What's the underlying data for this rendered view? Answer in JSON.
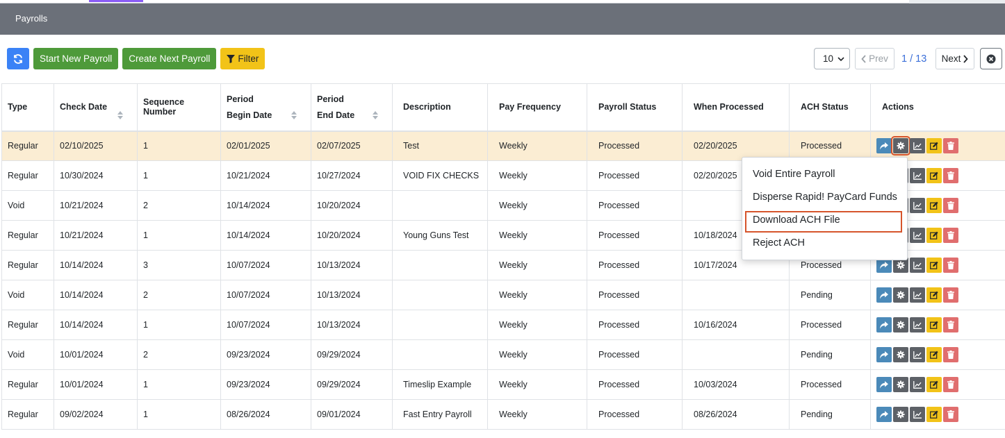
{
  "header": {
    "title": "Payrolls"
  },
  "toolbar": {
    "start_new": "Start New Payroll",
    "create_next": "Create Next Payroll",
    "filter": "Filter"
  },
  "pagination": {
    "per_page": "10",
    "prev": "Prev",
    "page": "1 / 13",
    "next": "Next"
  },
  "table": {
    "headers": {
      "type": "Type",
      "check_date": "Check Date",
      "sequence": "Sequence Number",
      "period_begin_1": "Period",
      "period_begin_2": "Begin Date",
      "period_end_1": "Period",
      "period_end_2": "End Date",
      "description": "Description",
      "pay_frequency": "Pay Frequency",
      "payroll_status": "Payroll Status",
      "when_processed": "When Processed",
      "ach_status": "ACH Status",
      "actions": "Actions"
    },
    "rows": [
      {
        "type": "Regular",
        "check_date": "02/10/2025",
        "seq": "1",
        "begin": "02/01/2025",
        "end": "02/07/2025",
        "desc": "Test",
        "freq": "Weekly",
        "status": "Processed",
        "when": "02/20/2025",
        "ach": "Processed"
      },
      {
        "type": "Regular",
        "check_date": "10/30/2024",
        "seq": "1",
        "begin": "10/21/2024",
        "end": "10/27/2024",
        "desc": "VOID FIX CHECKS",
        "freq": "Weekly",
        "status": "Processed",
        "when": "02/20/2025",
        "ach": ""
      },
      {
        "type": "Void",
        "check_date": "10/21/2024",
        "seq": "2",
        "begin": "10/14/2024",
        "end": "10/20/2024",
        "desc": "",
        "freq": "Weekly",
        "status": "Processed",
        "when": "",
        "ach": ""
      },
      {
        "type": "Regular",
        "check_date": "10/21/2024",
        "seq": "1",
        "begin": "10/14/2024",
        "end": "10/20/2024",
        "desc": "Young Guns Test",
        "freq": "Weekly",
        "status": "Processed",
        "when": "10/18/2024",
        "ach": ""
      },
      {
        "type": "Regular",
        "check_date": "10/14/2024",
        "seq": "3",
        "begin": "10/07/2024",
        "end": "10/13/2024",
        "desc": "",
        "freq": "Weekly",
        "status": "Processed",
        "when": "10/17/2024",
        "ach": "Processed"
      },
      {
        "type": "Void",
        "check_date": "10/14/2024",
        "seq": "2",
        "begin": "10/07/2024",
        "end": "10/13/2024",
        "desc": "",
        "freq": "Weekly",
        "status": "Processed",
        "when": "",
        "ach": "Pending"
      },
      {
        "type": "Regular",
        "check_date": "10/14/2024",
        "seq": "1",
        "begin": "10/07/2024",
        "end": "10/13/2024",
        "desc": "",
        "freq": "Weekly",
        "status": "Processed",
        "when": "10/16/2024",
        "ach": "Processed"
      },
      {
        "type": "Void",
        "check_date": "10/01/2024",
        "seq": "2",
        "begin": "09/23/2024",
        "end": "09/29/2024",
        "desc": "",
        "freq": "Weekly",
        "status": "Processed",
        "when": "",
        "ach": "Pending"
      },
      {
        "type": "Regular",
        "check_date": "10/01/2024",
        "seq": "1",
        "begin": "09/23/2024",
        "end": "09/29/2024",
        "desc": "Timeslip Example",
        "freq": "Weekly",
        "status": "Processed",
        "when": "10/03/2024",
        "ach": "Processed"
      },
      {
        "type": "Regular",
        "check_date": "09/02/2024",
        "seq": "1",
        "begin": "08/26/2024",
        "end": "09/01/2024",
        "desc": "Fast Entry Payroll",
        "freq": "Weekly",
        "status": "Processed",
        "when": "08/26/2024",
        "ach": "Pending"
      }
    ]
  },
  "dropdown": {
    "items": [
      {
        "label": "Void Entire Payroll"
      },
      {
        "label": "Disperse Rapid! PayCard Funds"
      },
      {
        "label": "Download ACH File"
      },
      {
        "label": "Reject ACH"
      }
    ]
  },
  "colors": {
    "header_bg": "#6b7079",
    "selected_row": "#fbedd3",
    "highlight": "#d6542b"
  }
}
